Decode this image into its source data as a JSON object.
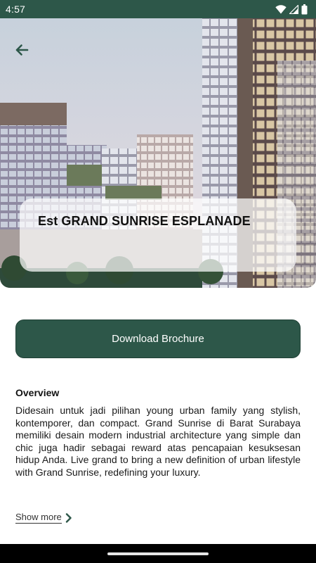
{
  "status_bar": {
    "time": "4:57",
    "icons": [
      "wifi-icon",
      "signal-icon",
      "battery-icon"
    ]
  },
  "hero": {
    "title": "Est GRAND SUNRISE ESPLANADE",
    "back_icon": "arrow-left-icon"
  },
  "actions": {
    "download_label": "Download Brochure"
  },
  "overview": {
    "heading": "Overview",
    "body": "Didesain untuk jadi pilihan young urban family yang stylish, kontemporer, dan compact. Grand Sunrise di Barat Surabaya memiliki desain modern industrial architecture yang simple dan chic juga hadir sebagai reward atas pencapaian kesuksesan hidup Anda.  Live grand to bring a new definition of urban lifestyle with Grand Sunrise, redefining your luxury.",
    "show_more_label": "Show more"
  },
  "colors": {
    "primary": "#2d5749",
    "status_bar": "#2d5749",
    "text": "#111111"
  }
}
